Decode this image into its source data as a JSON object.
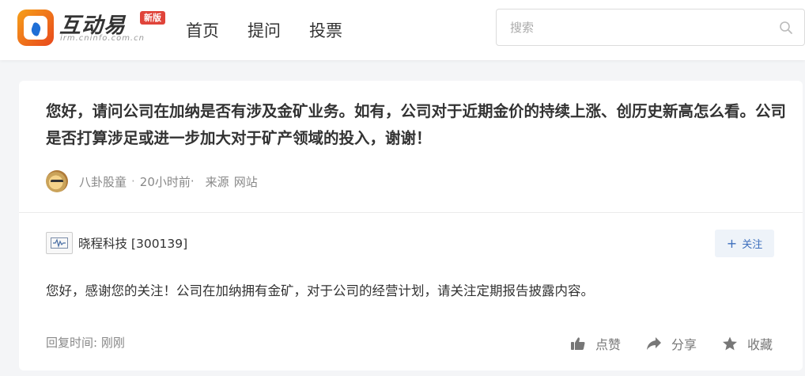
{
  "header": {
    "brand_cn": "互动易",
    "brand_en": "irm.cninfo.com.cn",
    "badge": "新版",
    "nav": [
      {
        "label": "首页"
      },
      {
        "label": "提问"
      },
      {
        "label": "投票"
      }
    ],
    "search": {
      "placeholder": "搜索",
      "value": "",
      "icon": "search-icon"
    }
  },
  "question": {
    "text": "您好，请问公司在加纳是否有涉及金矿业务。如有，公司对于近期金价的持续上涨、创历史新高怎么看。公司是否打算涉足或进一步加大对于矿产领域的投入，谢谢！",
    "user": "八卦股童",
    "time": "20小时前",
    "time_suffix": "·",
    "source_label": "来源",
    "source": "网站"
  },
  "answer": {
    "company": "晓程科技 [300139]",
    "follow_label": "关注",
    "text": "您好，感谢您的关注！公司在加纳拥有金矿，对于公司的经营计划，请关注定期报告披露内容。",
    "reply_label": "回复时间:",
    "reply_time": "刚刚",
    "actions": {
      "like": "点赞",
      "share": "分享",
      "collect": "收藏"
    }
  },
  "colors": {
    "accent": "#3d6fbd",
    "badge": "#e0443a",
    "logo_orange": "#f6a01a",
    "logo_blue": "#1f6fd6"
  }
}
